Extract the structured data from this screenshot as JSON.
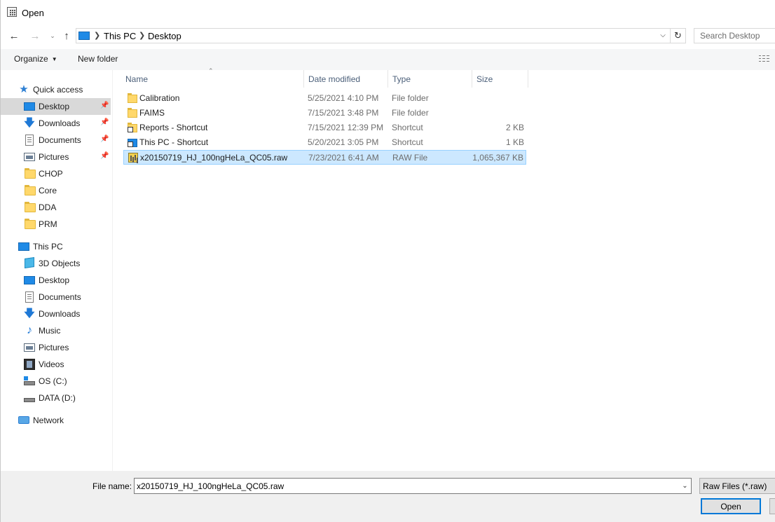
{
  "window": {
    "title": "Open"
  },
  "address": {
    "crumbs": [
      "This PC",
      "Desktop"
    ],
    "search_placeholder": "Search Desktop"
  },
  "toolbar": {
    "organize_label": "Organize",
    "new_folder_label": "New folder"
  },
  "nav": {
    "quick_access": "Quick access",
    "quick_items": [
      {
        "label": "Desktop",
        "icon": "monitor-icon",
        "pinned": true
      },
      {
        "label": "Downloads",
        "icon": "download-arrow-icon",
        "pinned": true
      },
      {
        "label": "Documents",
        "icon": "document-icon",
        "pinned": true
      },
      {
        "label": "Pictures",
        "icon": "pictures-icon",
        "pinned": true
      },
      {
        "label": "CHOP",
        "icon": "folder-icon"
      },
      {
        "label": "Core",
        "icon": "folder-icon"
      },
      {
        "label": "DDA",
        "icon": "folder-icon"
      },
      {
        "label": "PRM",
        "icon": "folder-icon"
      }
    ],
    "this_pc": "This PC",
    "pc_items": [
      {
        "label": "3D Objects",
        "icon": "3d-objects-icon"
      },
      {
        "label": "Desktop",
        "icon": "monitor-icon"
      },
      {
        "label": "Documents",
        "icon": "document-icon"
      },
      {
        "label": "Downloads",
        "icon": "download-arrow-icon"
      },
      {
        "label": "Music",
        "icon": "music-note-icon"
      },
      {
        "label": "Pictures",
        "icon": "pictures-icon"
      },
      {
        "label": "Videos",
        "icon": "video-icon"
      },
      {
        "label": "OS (C:)",
        "icon": "os-drive-icon"
      },
      {
        "label": "DATA (D:)",
        "icon": "drive-icon"
      }
    ],
    "network": "Network"
  },
  "columns": {
    "name": "Name",
    "date": "Date modified",
    "type": "Type",
    "size": "Size"
  },
  "files": [
    {
      "name": "Calibration",
      "date": "5/25/2021 4:10 PM",
      "type": "File folder",
      "size": ""
    },
    {
      "name": "FAIMS",
      "date": "7/15/2021 3:48 PM",
      "type": "File folder",
      "size": ""
    },
    {
      "name": "Reports - Shortcut",
      "date": "7/15/2021 12:39 PM",
      "type": "Shortcut",
      "size": "2 KB"
    },
    {
      "name": "This PC - Shortcut",
      "date": "5/20/2021 3:05 PM",
      "type": "Shortcut",
      "size": "1 KB"
    },
    {
      "name": "x20150719_HJ_100ngHeLa_QC05.raw",
      "date": "7/23/2021 6:41 AM",
      "type": "RAW File",
      "size": "1,065,367 KB"
    }
  ],
  "footer": {
    "file_name_label": "File name:",
    "file_name_value": "x20150719_HJ_100ngHeLa_QC05.raw",
    "filter_label": "Raw Files (*.raw)",
    "open_label": "Open"
  }
}
